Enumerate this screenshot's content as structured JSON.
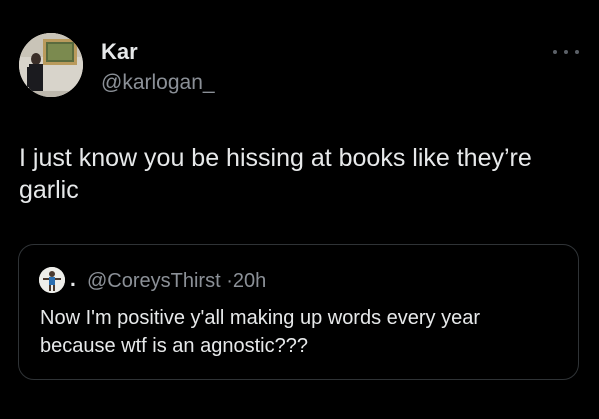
{
  "tweet": {
    "author": {
      "display_name": "Kar",
      "handle": "@karlogan_"
    },
    "more_icon": "more-horizontal-icon",
    "text": "I just know you be hissing at books like they’re garlic"
  },
  "quoted_tweet": {
    "prefix": ".",
    "handle": "@CoreysThirst",
    "separator": "·",
    "time": "20h",
    "text": "Now I'm positive y'all making up words every year because wtf is an agnostic???"
  },
  "colors": {
    "background": "#000000",
    "primary_text": "#e7e9ea",
    "secondary_text": "#8b9097",
    "border": "#2f3336"
  }
}
